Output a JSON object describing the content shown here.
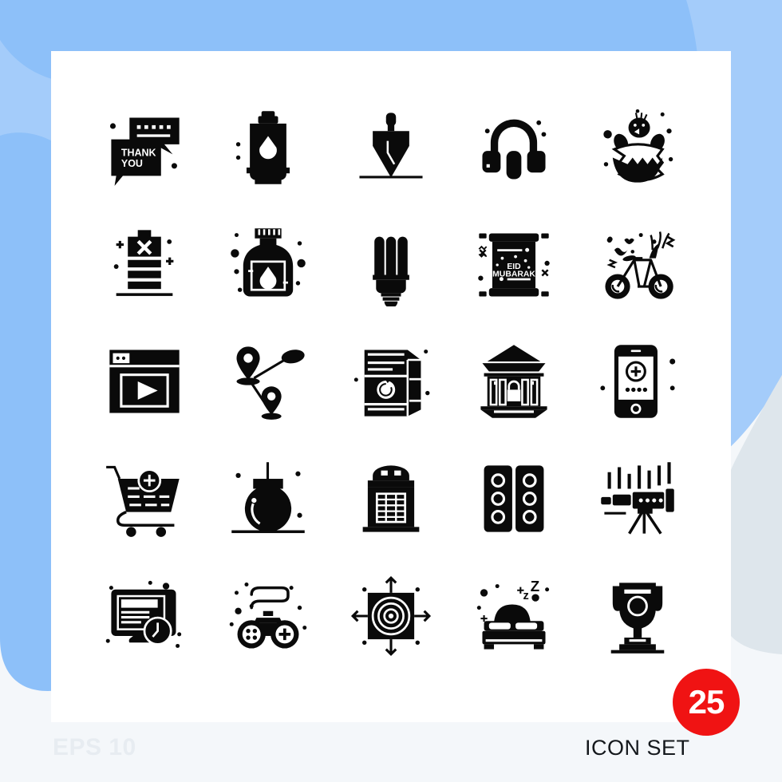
{
  "meta": {
    "eps_label": "EPS 10",
    "set_label": "ICON SET",
    "count": "25"
  },
  "colors": {
    "background_light_blue": "#a4ccfa",
    "background_blue": "#8dc0f9",
    "background_gray": "#f4f7fa",
    "background_gray_blob": "#dee6ec",
    "card": "#ffffff",
    "icon": "#0a0a0a",
    "badge": "#f01313",
    "badge_text": "#ffffff",
    "eps_text": "#e7ecf1",
    "set_text": "#14181c"
  },
  "icons": [
    {
      "row": 1,
      "col": 1,
      "name": "thank-you-chat-icon",
      "label": "Thank You Message",
      "text": [
        "THANK",
        "YOU"
      ]
    },
    {
      "row": 1,
      "col": 2,
      "name": "gas-cylinder-icon",
      "label": "Gas Cylinder",
      "text": []
    },
    {
      "row": 1,
      "col": 3,
      "name": "trowel-icon",
      "label": "Trowel",
      "text": []
    },
    {
      "row": 1,
      "col": 4,
      "name": "headphones-icon",
      "label": "Headphones",
      "text": []
    },
    {
      "row": 1,
      "col": 5,
      "name": "hatching-chick-icon",
      "label": "Hatching Chick",
      "text": []
    },
    {
      "row": 2,
      "col": 1,
      "name": "dead-battery-icon",
      "label": "Dead Battery",
      "text": []
    },
    {
      "row": 2,
      "col": 2,
      "name": "ink-bottle-icon",
      "label": "Ink Bottle",
      "text": []
    },
    {
      "row": 2,
      "col": 3,
      "name": "cfl-bulb-icon",
      "label": "Energy Saver Bulb",
      "text": []
    },
    {
      "row": 2,
      "col": 4,
      "name": "eid-mubarak-scroll-icon",
      "label": "Eid Mubarak Card",
      "text": [
        "EID",
        "MUBARAK"
      ]
    },
    {
      "row": 2,
      "col": 5,
      "name": "bicycle-icon",
      "label": "Bicycle",
      "text": []
    },
    {
      "row": 3,
      "col": 1,
      "name": "video-browser-icon",
      "label": "Video Player Window",
      "text": []
    },
    {
      "row": 3,
      "col": 2,
      "name": "route-pins-icon",
      "label": "Route Map Pins",
      "text": []
    },
    {
      "row": 3,
      "col": 3,
      "name": "juice-carton-icon",
      "label": "Juice Carton",
      "text": []
    },
    {
      "row": 3,
      "col": 4,
      "name": "secure-bank-icon",
      "label": "Secure Bank",
      "text": []
    },
    {
      "row": 3,
      "col": 5,
      "name": "mobile-add-icon",
      "label": "Mobile Add",
      "text": []
    },
    {
      "row": 4,
      "col": 1,
      "name": "add-to-cart-icon",
      "label": "Add To Cart",
      "text": []
    },
    {
      "row": 4,
      "col": 2,
      "name": "bomb-icon",
      "label": "Bomb",
      "text": []
    },
    {
      "row": 4,
      "col": 3,
      "name": "mailbox-icon",
      "label": "Mailbox",
      "text": []
    },
    {
      "row": 4,
      "col": 4,
      "name": "dominoes-icon",
      "label": "Dominoes",
      "text": []
    },
    {
      "row": 4,
      "col": 5,
      "name": "telescope-icon",
      "label": "Telescope",
      "text": []
    },
    {
      "row": 5,
      "col": 1,
      "name": "online-time-monitor-icon",
      "label": "Monitor With Clock",
      "text": []
    },
    {
      "row": 5,
      "col": 2,
      "name": "vr-gamepad-icon",
      "label": "Game Controller",
      "text": []
    },
    {
      "row": 5,
      "col": 3,
      "name": "target-arrows-icon",
      "label": "Target With Arrows",
      "text": []
    },
    {
      "row": 5,
      "col": 4,
      "name": "sleeping-bed-icon",
      "label": "Bed Sleeping",
      "text": [
        "z",
        "Z"
      ]
    },
    {
      "row": 5,
      "col": 5,
      "name": "trophy-icon",
      "label": "Trophy",
      "text": []
    }
  ]
}
